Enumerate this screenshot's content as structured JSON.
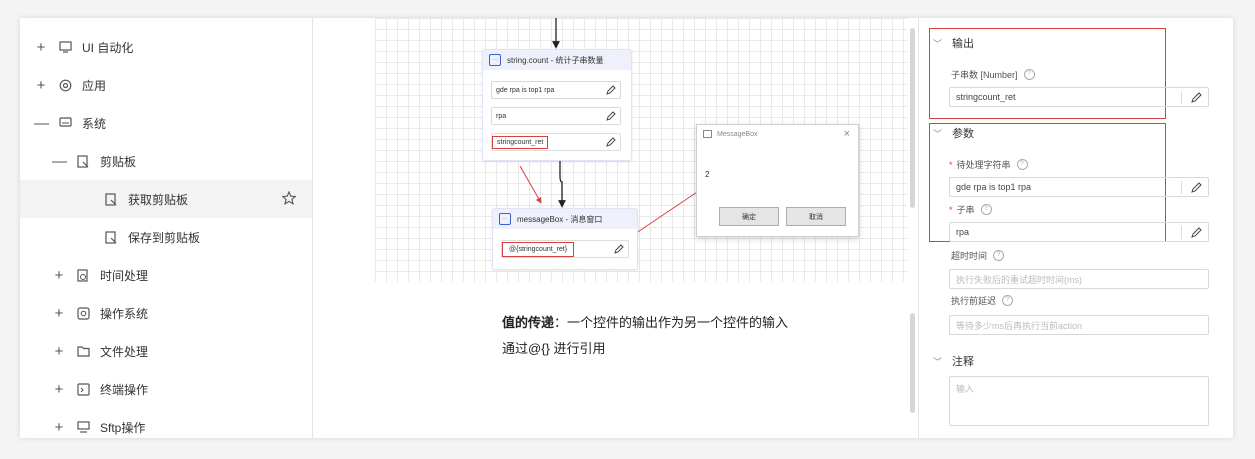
{
  "tree": {
    "items": [
      {
        "toggle": "+",
        "icon": "ui-automation-icon",
        "label": "UI 自动化"
      },
      {
        "toggle": "+",
        "icon": "app-icon",
        "label": "应用"
      },
      {
        "toggle": "—",
        "icon": "system-icon",
        "label": "系统"
      },
      {
        "toggle": "—",
        "icon": "clipboard-icon",
        "label": "剪贴板"
      },
      {
        "toggle": "",
        "icon": "clipboard-icon",
        "label": "获取剪贴板"
      },
      {
        "toggle": "",
        "icon": "clipboard-icon",
        "label": "保存到剪贴板"
      },
      {
        "toggle": "+",
        "icon": "time-icon",
        "label": "时间处理"
      },
      {
        "toggle": "+",
        "icon": "os-icon",
        "label": "操作系统"
      },
      {
        "toggle": "+",
        "icon": "folder-icon",
        "label": "文件处理"
      },
      {
        "toggle": "+",
        "icon": "terminal-icon",
        "label": "终端操作"
      },
      {
        "toggle": "+",
        "icon": "sftp-icon",
        "label": "Sftp操作"
      }
    ]
  },
  "canvas": {
    "node1": {
      "title": "string.count - 统计子串数量",
      "fields": [
        "gde rpa is top1 rpa",
        "rpa",
        "stringcount_ret"
      ]
    },
    "node2": {
      "title": "messageBox - 消息窗口",
      "fields": [
        "@{stringcount_ret}"
      ]
    },
    "messagebox": {
      "title": "MessageBox",
      "content": "2",
      "ok": "确定",
      "cancel": "取消"
    }
  },
  "caption": {
    "line1_bold": "值的传递",
    "line1_rest": "：一个控件的输出作为另一个控件的输入",
    "line2": "通过@{} 进行引用"
  },
  "panel": {
    "output": {
      "section": "输出",
      "label": "子串数 [Number]",
      "value": "stringcount_ret"
    },
    "params": {
      "section": "参数",
      "p1_label": "待处理字符串",
      "p1_value": "gde rpa is top1 rpa",
      "p2_label": "子串",
      "p2_value": "rpa",
      "timeout_label": "超时时间",
      "timeout_placeholder": "执行失败后的重试超时时间(ms)",
      "delay_label": "执行前延迟",
      "delay_placeholder": "等待多少ms后再执行当前action"
    },
    "notes": {
      "section": "注释",
      "placeholder": "输入"
    }
  },
  "colors": {
    "accent": "#3a62d7",
    "highlight": "#d84040"
  }
}
